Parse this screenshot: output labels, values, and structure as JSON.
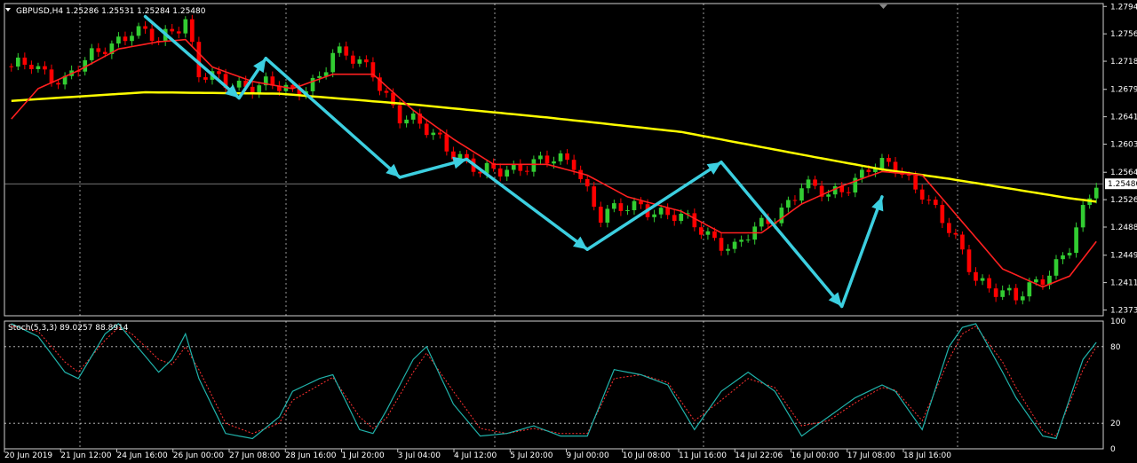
{
  "chart_data": [
    {
      "type": "candlestick",
      "header": "GBPUSD,H4  1.25286 1.25531 1.25284 1.25480",
      "ylim": [
        1.2365,
        1.2798
      ],
      "y_ticks": [
        {
          "value": 1.2794,
          "label": "1.27940"
        },
        {
          "value": 1.2756,
          "label": "1.27560"
        },
        {
          "value": 1.2718,
          "label": "1.27180"
        },
        {
          "value": 1.2679,
          "label": "1.26790"
        },
        {
          "value": 1.2641,
          "label": "1.26410"
        },
        {
          "value": 1.2603,
          "label": "1.26030"
        },
        {
          "value": 1.2564,
          "label": "1.25640"
        },
        {
          "value": 1.2526,
          "label": "1.25260"
        },
        {
          "value": 1.2488,
          "label": "1.24880"
        },
        {
          "value": 1.2449,
          "label": "1.24490"
        },
        {
          "value": 1.2411,
          "label": "1.24110"
        },
        {
          "value": 1.2373,
          "label": "1.23730"
        }
      ],
      "current_price": {
        "value": 1.2548,
        "label": "1.25480"
      },
      "x_ticks": [
        "20 Jun 2019",
        "21 Jun 12:00",
        "24 Jun 16:00",
        "26 Jun 00:00",
        "27 Jun 08:00",
        "28 Jun 16:00",
        "1 Jul 20:00",
        "3 Jul 04:00",
        "4 Jul 12:00",
        "5 Jul 20:00",
        "9 Jul 00:00",
        "10 Jul 08:00",
        "11 Jul 16:00",
        "14 Jul 22:06",
        "16 Jul 00:00",
        "17 Jul 08:00",
        "18 Jul 16:00"
      ],
      "candle_count": 163,
      "close_anchors": [
        [
          0,
          1.2705
        ],
        [
          3,
          1.2715
        ],
        [
          8,
          1.269
        ],
        [
          14,
          1.274
        ],
        [
          18,
          1.276
        ],
        [
          22,
          1.2745
        ],
        [
          26,
          1.278
        ],
        [
          28,
          1.27
        ],
        [
          32,
          1.2685
        ],
        [
          38,
          1.2688
        ],
        [
          42,
          1.267
        ],
        [
          46,
          1.27
        ],
        [
          48,
          1.273
        ],
        [
          54,
          1.2705
        ],
        [
          58,
          1.264
        ],
        [
          64,
          1.2612
        ],
        [
          70,
          1.256
        ],
        [
          76,
          1.2575
        ],
        [
          84,
          1.258
        ],
        [
          88,
          1.2502
        ],
        [
          94,
          1.252
        ],
        [
          102,
          1.249
        ],
        [
          108,
          1.2458
        ],
        [
          114,
          1.2505
        ],
        [
          118,
          1.2545
        ],
        [
          122,
          1.253
        ],
        [
          128,
          1.257
        ],
        [
          132,
          1.257
        ],
        [
          136,
          1.254
        ],
        [
          144,
          1.242
        ],
        [
          150,
          1.2385
        ],
        [
          154,
          1.242
        ],
        [
          158,
          1.246
        ],
        [
          162,
          1.2548
        ]
      ],
      "ma_fast": [
        [
          0,
          1.2638
        ],
        [
          4,
          1.268
        ],
        [
          10,
          1.2705
        ],
        [
          16,
          1.2735
        ],
        [
          22,
          1.2745
        ],
        [
          26,
          1.2748
        ],
        [
          30,
          1.271
        ],
        [
          36,
          1.269
        ],
        [
          42,
          1.268
        ],
        [
          48,
          1.27
        ],
        [
          54,
          1.27
        ],
        [
          60,
          1.265
        ],
        [
          66,
          1.261
        ],
        [
          72,
          1.2575
        ],
        [
          80,
          1.2575
        ],
        [
          86,
          1.256
        ],
        [
          92,
          1.253
        ],
        [
          100,
          1.251
        ],
        [
          106,
          1.248
        ],
        [
          112,
          1.248
        ],
        [
          118,
          1.252
        ],
        [
          124,
          1.2545
        ],
        [
          130,
          1.2565
        ],
        [
          136,
          1.256
        ],
        [
          142,
          1.2495
        ],
        [
          148,
          1.243
        ],
        [
          154,
          1.2405
        ],
        [
          158,
          1.242
        ],
        [
          163,
          1.248
        ]
      ],
      "ma_slow": [
        [
          0,
          1.2663
        ],
        [
          20,
          1.2675
        ],
        [
          40,
          1.2673
        ],
        [
          60,
          1.2658
        ],
        [
          80,
          1.264
        ],
        [
          100,
          1.262
        ],
        [
          120,
          1.2585
        ],
        [
          130,
          1.2568
        ],
        [
          140,
          1.2555
        ],
        [
          150,
          1.254
        ],
        [
          158,
          1.2528
        ],
        [
          163,
          1.2522
        ]
      ],
      "arrows": [
        [
          20,
          1.278
        ],
        [
          34,
          1.2667
        ],
        [
          38,
          1.2722
        ],
        [
          58,
          1.2557
        ],
        [
          68,
          1.2582
        ],
        [
          86,
          1.2457
        ],
        [
          106,
          1.2578
        ],
        [
          124,
          1.2378
        ],
        [
          130,
          1.253
        ]
      ]
    },
    {
      "type": "line",
      "header": "Stoch(5,3,3) 89.0257 88.8914",
      "ylim": [
        0,
        100
      ],
      "y_ticks": [
        {
          "value": 100,
          "label": "100"
        },
        {
          "value": 80,
          "label": "80"
        },
        {
          "value": 20,
          "label": "20"
        },
        {
          "value": 0,
          "label": "0"
        }
      ],
      "levels": [
        80,
        20
      ],
      "main": [
        [
          0,
          98
        ],
        [
          4,
          88
        ],
        [
          8,
          60
        ],
        [
          10,
          55
        ],
        [
          14,
          90
        ],
        [
          16,
          98
        ],
        [
          18,
          85
        ],
        [
          22,
          60
        ],
        [
          24,
          70
        ],
        [
          26,
          90
        ],
        [
          28,
          55
        ],
        [
          32,
          12
        ],
        [
          36,
          8
        ],
        [
          40,
          25
        ],
        [
          42,
          45
        ],
        [
          46,
          55
        ],
        [
          48,
          58
        ],
        [
          52,
          15
        ],
        [
          54,
          12
        ],
        [
          56,
          30
        ],
        [
          60,
          70
        ],
        [
          62,
          80
        ],
        [
          66,
          35
        ],
        [
          70,
          10
        ],
        [
          74,
          12
        ],
        [
          78,
          18
        ],
        [
          82,
          10
        ],
        [
          86,
          10
        ],
        [
          90,
          62
        ],
        [
          94,
          58
        ],
        [
          98,
          50
        ],
        [
          102,
          15
        ],
        [
          106,
          45
        ],
        [
          110,
          60
        ],
        [
          114,
          45
        ],
        [
          118,
          10
        ],
        [
          122,
          25
        ],
        [
          126,
          40
        ],
        [
          130,
          50
        ],
        [
          132,
          45
        ],
        [
          136,
          15
        ],
        [
          140,
          80
        ],
        [
          142,
          95
        ],
        [
          144,
          98
        ],
        [
          148,
          60
        ],
        [
          150,
          40
        ],
        [
          154,
          10
        ],
        [
          156,
          8
        ],
        [
          160,
          70
        ],
        [
          163,
          90
        ]
      ],
      "signal": [
        [
          0,
          96
        ],
        [
          4,
          92
        ],
        [
          8,
          68
        ],
        [
          10,
          60
        ],
        [
          14,
          85
        ],
        [
          16,
          95
        ],
        [
          18,
          90
        ],
        [
          22,
          70
        ],
        [
          24,
          66
        ],
        [
          26,
          80
        ],
        [
          28,
          62
        ],
        [
          32,
          20
        ],
        [
          36,
          12
        ],
        [
          40,
          20
        ],
        [
          42,
          38
        ],
        [
          46,
          50
        ],
        [
          48,
          56
        ],
        [
          52,
          25
        ],
        [
          54,
          16
        ],
        [
          56,
          24
        ],
        [
          60,
          60
        ],
        [
          62,
          75
        ],
        [
          66,
          45
        ],
        [
          70,
          16
        ],
        [
          74,
          12
        ],
        [
          78,
          16
        ],
        [
          82,
          12
        ],
        [
          86,
          12
        ],
        [
          90,
          55
        ],
        [
          94,
          58
        ],
        [
          98,
          52
        ],
        [
          102,
          22
        ],
        [
          106,
          38
        ],
        [
          110,
          55
        ],
        [
          114,
          48
        ],
        [
          118,
          18
        ],
        [
          122,
          22
        ],
        [
          126,
          36
        ],
        [
          130,
          48
        ],
        [
          132,
          46
        ],
        [
          136,
          22
        ],
        [
          140,
          70
        ],
        [
          142,
          90
        ],
        [
          144,
          96
        ],
        [
          148,
          68
        ],
        [
          150,
          48
        ],
        [
          154,
          14
        ],
        [
          156,
          10
        ],
        [
          160,
          62
        ],
        [
          163,
          89
        ]
      ]
    }
  ],
  "colors": {
    "background": "#000000",
    "bull": "#32cd32",
    "bear": "#ff0000",
    "ma_fast": "#ff2020",
    "ma_slow": "#ffff00",
    "arrow": "#3ccfe0",
    "stoch_main": "#20b2aa",
    "stoch_signal": "#ff3030",
    "grid": "#ffffff",
    "text": "#ffffff"
  }
}
